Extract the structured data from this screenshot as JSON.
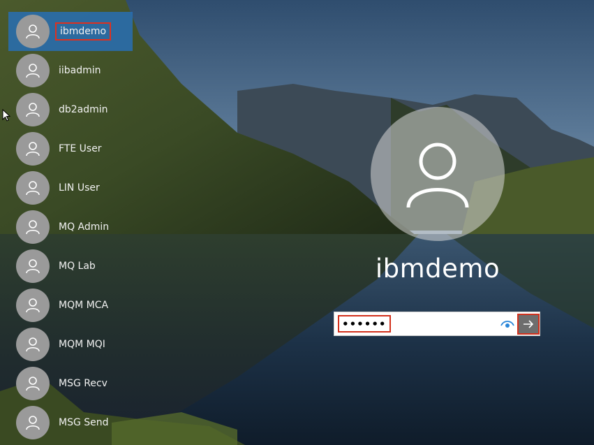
{
  "users": [
    {
      "name": "ibmdemo",
      "selected": true
    },
    {
      "name": "iibadmin"
    },
    {
      "name": "db2admin"
    },
    {
      "name": "FTE User"
    },
    {
      "name": "LIN User"
    },
    {
      "name": "MQ Admin"
    },
    {
      "name": "MQ Lab"
    },
    {
      "name": "MQM MCA"
    },
    {
      "name": "MQM MQI"
    },
    {
      "name": "MSG Recv"
    },
    {
      "name": "MSG Send"
    }
  ],
  "login": {
    "display_name": "ibmdemo",
    "password_value": "••••••••",
    "reveal_icon": "eye-icon",
    "submit_icon": "arrow-right-icon"
  },
  "colors": {
    "selected_bg": "#286eb4",
    "highlight_border": "#d2301c",
    "avatar_bg": "#9a9a9a"
  }
}
